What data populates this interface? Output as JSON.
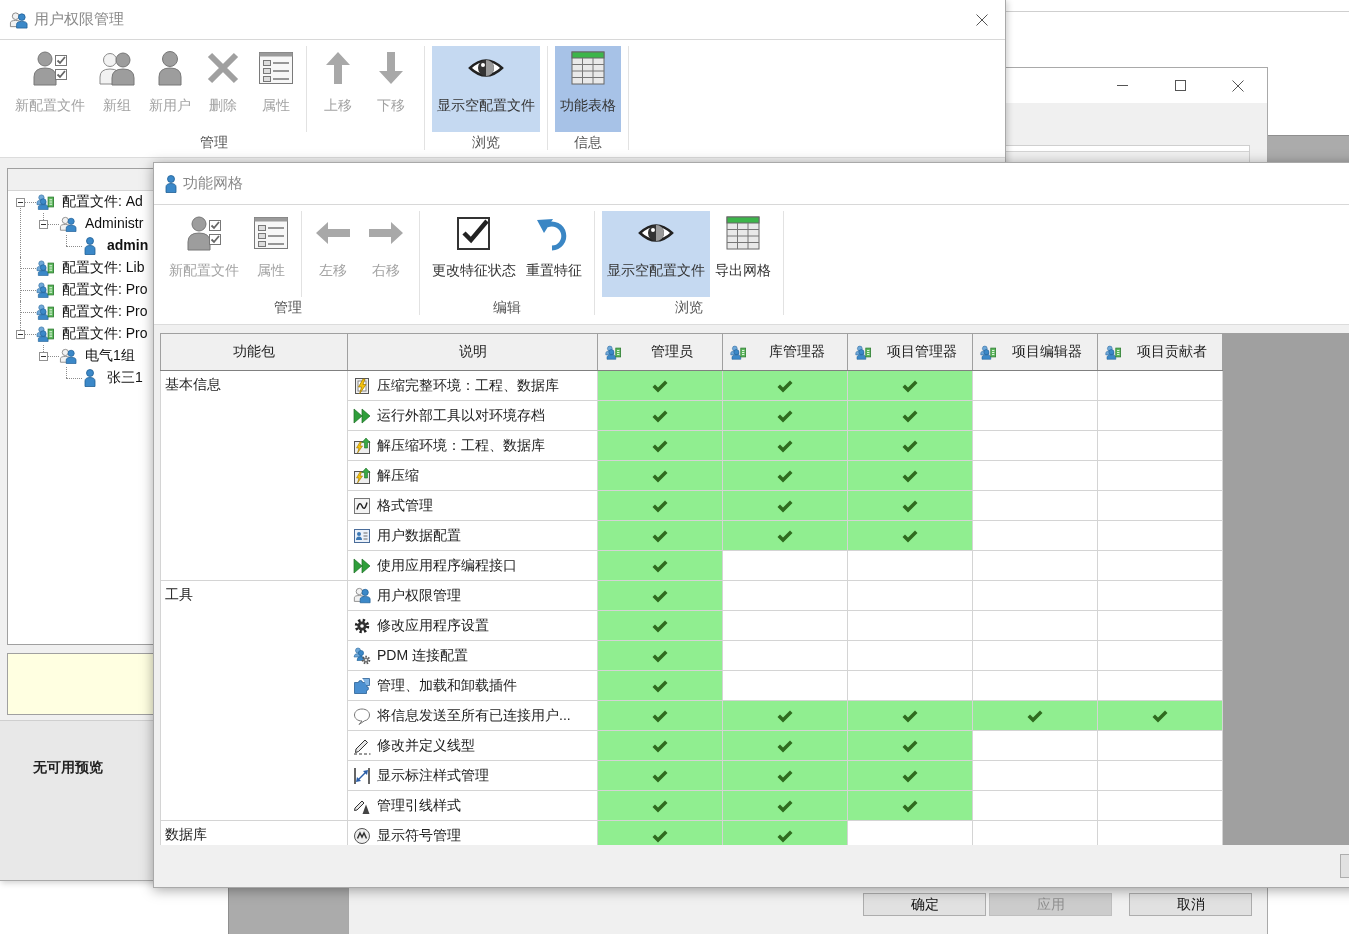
{
  "permissions_window": {
    "title": "用户权限管理",
    "toolbar": {
      "groups": [
        {
          "label": "管理",
          "sections": [
            {
              "buttons": [
                {
                  "label": "新配置文件",
                  "disabled": true,
                  "checked": false,
                  "hovered": false
                },
                {
                  "label": "新组",
                  "disabled": true,
                  "checked": false,
                  "hovered": false
                },
                {
                  "label": "新用户",
                  "disabled": true,
                  "checked": false,
                  "hovered": false
                },
                {
                  "label": "删除",
                  "disabled": true,
                  "checked": false,
                  "hovered": false
                },
                {
                  "label": "属性",
                  "disabled": true,
                  "checked": false,
                  "hovered": false
                }
              ]
            },
            {
              "buttons": [
                {
                  "label": "上移",
                  "disabled": true,
                  "checked": false,
                  "hovered": false
                },
                {
                  "label": "下移",
                  "disabled": true,
                  "checked": false,
                  "hovered": false
                }
              ]
            }
          ]
        },
        {
          "label": "浏览",
          "sections": [
            {
              "buttons": [
                {
                  "label": "显示空配置文件",
                  "disabled": false,
                  "checked": true,
                  "hovered": false
                }
              ]
            }
          ]
        },
        {
          "label": "信息",
          "sections": [
            {
              "buttons": [
                {
                  "label": "功能表格",
                  "disabled": false,
                  "checked": true,
                  "hovered": true
                }
              ]
            }
          ]
        }
      ]
    },
    "tree": [
      {
        "label": "配置文件: Ad",
        "kind": "profile",
        "expanded": true,
        "children": [
          {
            "label": "Administr",
            "kind": "group",
            "expanded": true,
            "children": [
              {
                "label": "admin",
                "kind": "user",
                "current": true
              }
            ]
          }
        ]
      },
      {
        "label": "配置文件: Lib",
        "kind": "profile"
      },
      {
        "label": "配置文件: Pro",
        "kind": "profile"
      },
      {
        "label": "配置文件: Pro",
        "kind": "profile"
      },
      {
        "label": "配置文件: Pro",
        "kind": "profile",
        "expanded": true,
        "children": [
          {
            "label": "电气1组",
            "kind": "group",
            "expanded": true,
            "children": [
              {
                "label": "张三1",
                "kind": "user",
                "current": false
              }
            ]
          }
        ]
      }
    ],
    "preview_message": "无可用预览"
  },
  "grid_window": {
    "title": "功能网格",
    "toolbar": {
      "groups": [
        {
          "label": "管理",
          "sections": [
            {
              "buttons": [
                {
                  "label": "新配置文件",
                  "disabled": true,
                  "checked": false,
                  "hovered": false
                },
                {
                  "label": "属性",
                  "disabled": true,
                  "checked": false,
                  "hovered": false
                }
              ]
            },
            {
              "buttons": [
                {
                  "label": "左移",
                  "disabled": true,
                  "checked": false,
                  "hovered": false
                },
                {
                  "label": "右移",
                  "disabled": true,
                  "checked": false,
                  "hovered": false
                }
              ]
            }
          ]
        },
        {
          "label": "编辑",
          "sections": [
            {
              "buttons": [
                {
                  "label": "更改特征状态",
                  "disabled": false,
                  "checked": false,
                  "hovered": false
                },
                {
                  "label": "重置特征",
                  "disabled": false,
                  "checked": false,
                  "hovered": false
                }
              ]
            }
          ]
        },
        {
          "label": "浏览",
          "sections": [
            {
              "buttons": [
                {
                  "label": "显示空配置文件",
                  "disabled": false,
                  "checked": true,
                  "hovered": false
                },
                {
                  "label": "导出网格",
                  "disabled": false,
                  "checked": false,
                  "hovered": false
                }
              ]
            }
          ]
        }
      ]
    },
    "grid": {
      "columns": [
        {
          "label": "功能包",
          "kind": "text"
        },
        {
          "label": "说明",
          "kind": "text"
        },
        {
          "label": "管理员",
          "kind": "profile"
        },
        {
          "label": "库管理器",
          "kind": "profile"
        },
        {
          "label": "项目管理器",
          "kind": "profile"
        },
        {
          "label": "项目编辑器",
          "kind": "profile"
        },
        {
          "label": "项目贡献者",
          "kind": "profile"
        }
      ],
      "groups": [
        {
          "name": "基本信息",
          "rows": [
            {
              "label": "压缩完整环境：工程、数据库",
              "cells": [
                {
                  "checked": true
                },
                {
                  "checked": true
                },
                {
                  "checked": true
                },
                {
                  "checked": false
                },
                {
                  "checked": false
                }
              ]
            },
            {
              "label": "运行外部工具以对环境存档",
              "cells": [
                {
                  "checked": true
                },
                {
                  "checked": true
                },
                {
                  "checked": true
                },
                {
                  "checked": false
                },
                {
                  "checked": false
                }
              ]
            },
            {
              "label": "解压缩环境：工程、数据库",
              "cells": [
                {
                  "checked": true
                },
                {
                  "checked": true
                },
                {
                  "checked": true
                },
                {
                  "checked": false
                },
                {
                  "checked": false
                }
              ]
            },
            {
              "label": "解压缩",
              "cells": [
                {
                  "checked": true
                },
                {
                  "checked": true
                },
                {
                  "checked": true
                },
                {
                  "checked": false
                },
                {
                  "checked": false
                }
              ]
            },
            {
              "label": "格式管理",
              "cells": [
                {
                  "checked": true
                },
                {
                  "checked": true
                },
                {
                  "checked": true
                },
                {
                  "checked": false
                },
                {
                  "checked": false
                }
              ]
            },
            {
              "label": "用户数据配置",
              "cells": [
                {
                  "checked": true
                },
                {
                  "checked": true
                },
                {
                  "checked": true
                },
                {
                  "checked": false
                },
                {
                  "checked": false
                }
              ]
            },
            {
              "label": "使用应用程序编程接口",
              "cells": [
                {
                  "checked": true
                },
                {
                  "checked": false
                },
                {
                  "checked": false
                },
                {
                  "checked": false
                },
                {
                  "checked": false
                }
              ]
            }
          ]
        },
        {
          "name": "工具",
          "rows": [
            {
              "label": "用户权限管理",
              "cells": [
                {
                  "checked": true
                },
                {
                  "checked": false
                },
                {
                  "checked": false
                },
                {
                  "checked": false
                },
                {
                  "checked": false
                }
              ]
            },
            {
              "label": "修改应用程序设置",
              "cells": [
                {
                  "checked": true
                },
                {
                  "checked": false
                },
                {
                  "checked": false
                },
                {
                  "checked": false
                },
                {
                  "checked": false
                }
              ]
            },
            {
              "label": "PDM 连接配置",
              "cells": [
                {
                  "checked": true
                },
                {
                  "checked": false
                },
                {
                  "checked": false
                },
                {
                  "checked": false
                },
                {
                  "checked": false
                }
              ]
            },
            {
              "label": "管理、加载和卸载插件",
              "cells": [
                {
                  "checked": true
                },
                {
                  "checked": false
                },
                {
                  "checked": false
                },
                {
                  "checked": false
                },
                {
                  "checked": false
                }
              ]
            },
            {
              "label": "将信息发送至所有已连接用户...",
              "cells": [
                {
                  "checked": true
                },
                {
                  "checked": true
                },
                {
                  "checked": true
                },
                {
                  "checked": true
                },
                {
                  "checked": true
                }
              ]
            },
            {
              "label": "修改并定义线型",
              "cells": [
                {
                  "checked": true
                },
                {
                  "checked": true
                },
                {
                  "checked": true
                },
                {
                  "checked": false
                },
                {
                  "checked": false
                }
              ]
            },
            {
              "label": "显示标注样式管理",
              "cells": [
                {
                  "checked": true
                },
                {
                  "checked": true
                },
                {
                  "checked": true
                },
                {
                  "checked": false
                },
                {
                  "checked": false
                }
              ]
            },
            {
              "label": "管理引线样式",
              "cells": [
                {
                  "checked": true
                },
                {
                  "checked": true
                },
                {
                  "checked": true
                },
                {
                  "checked": false
                },
                {
                  "checked": false
                }
              ]
            }
          ]
        },
        {
          "name": "数据库",
          "rows": [
            {
              "label": "显示符号管理",
              "cells": [
                {
                  "checked": true
                },
                {
                  "checked": true
                },
                {
                  "checked": false
                },
                {
                  "checked": false
                },
                {
                  "checked": false
                }
              ]
            }
          ]
        }
      ]
    }
  },
  "dialog_window": {
    "buttons": [
      {
        "label": "确定",
        "disabled": false
      },
      {
        "label": "应用",
        "disabled": true
      },
      {
        "label": "取消",
        "disabled": false
      }
    ]
  }
}
